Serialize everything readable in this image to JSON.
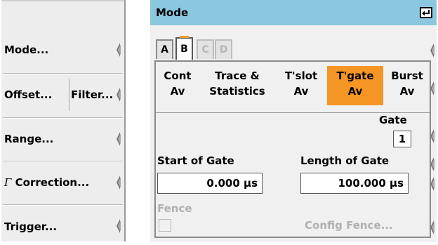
{
  "softkeys": {
    "mode": "Mode...",
    "offset": "Offset...",
    "filter": "Filter...",
    "range": "Range...",
    "correction_symbol": "Γ",
    "correction": " Correction...",
    "trigger": "Trigger..."
  },
  "panel": {
    "title": "Mode",
    "tabs": [
      {
        "label": "A",
        "state": "normal"
      },
      {
        "label": "B",
        "state": "active"
      },
      {
        "label": "C",
        "state": "disabled"
      },
      {
        "label": "D",
        "state": "disabled"
      }
    ],
    "measurements": [
      {
        "line1": "Cont",
        "line2": "Av",
        "selected": false
      },
      {
        "line1": "Trace &",
        "line2": "Statistics",
        "selected": false
      },
      {
        "line1": "T'slot",
        "line2": "Av",
        "selected": false
      },
      {
        "line1": "T'gate",
        "line2": "Av",
        "selected": true
      },
      {
        "line1": "Burst",
        "line2": "Av",
        "selected": false
      }
    ],
    "gate_label": "Gate",
    "gate_value": "1",
    "start_of_gate_label": "Start of Gate",
    "start_of_gate_value": "0.000 µs",
    "length_of_gate_label": "Length of Gate",
    "length_of_gate_value": "100.000 µs",
    "fence_label": "Fence",
    "config_fence_label": "Config Fence..."
  },
  "colors": {
    "title_bar": "#8cc7e0",
    "selected_highlight": "#f59624"
  }
}
